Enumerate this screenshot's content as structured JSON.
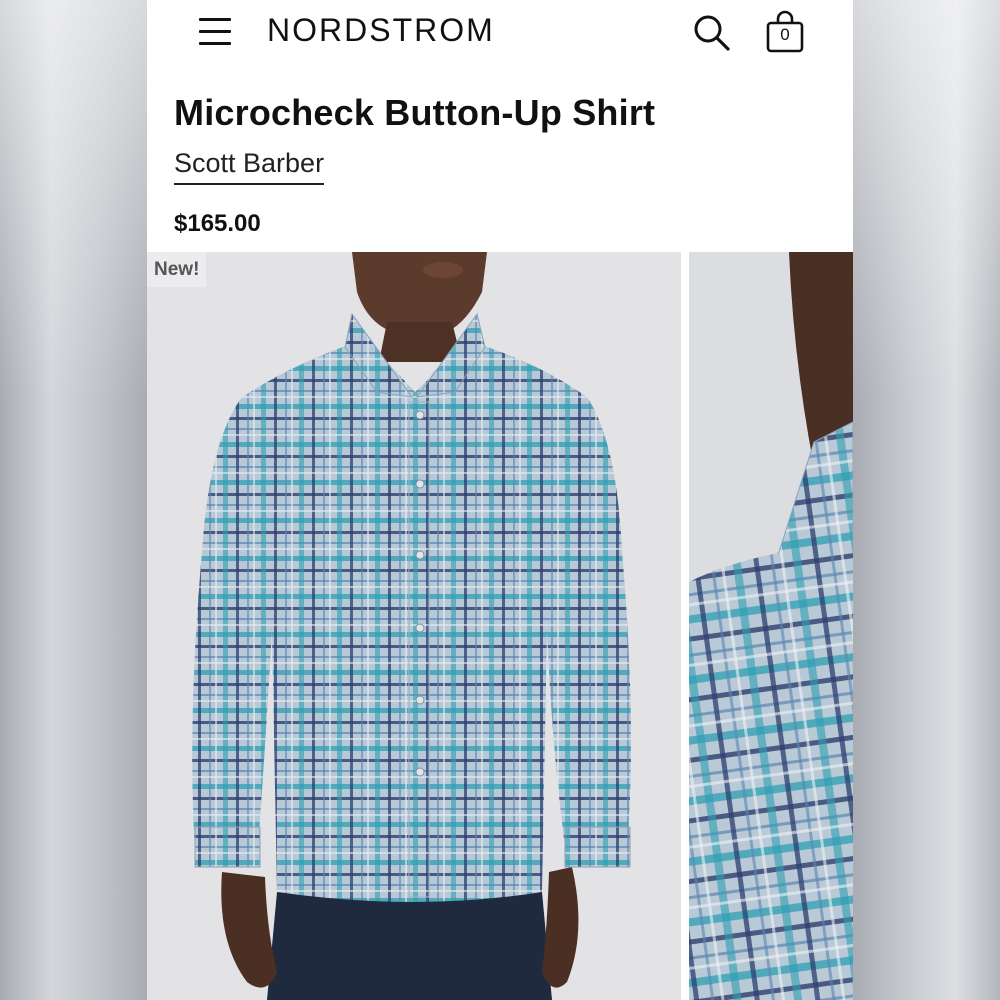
{
  "header": {
    "logo": "NORDSTROM",
    "bag_count": "0",
    "icons": [
      "hamburger-menu-icon",
      "search-icon",
      "shopping-bag-icon"
    ]
  },
  "product": {
    "title": "Microcheck Button-Up Shirt",
    "brand": "Scott Barber",
    "price": "$165.00",
    "badge": "New!"
  },
  "colors": {
    "text": "#111111",
    "shirt_blue": "#7fa9c6",
    "shirt_teal": "#2f9fb3",
    "shirt_navy": "#2d3f6e",
    "background_photo": "#e3e3e6"
  }
}
